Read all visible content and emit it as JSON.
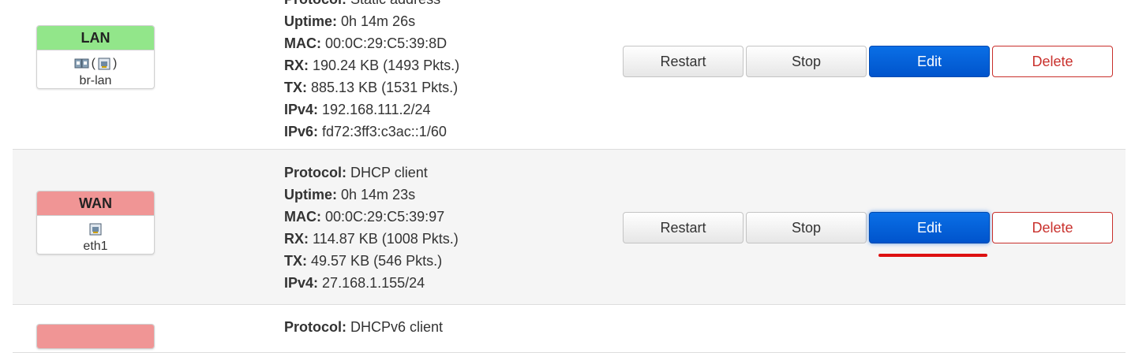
{
  "colors": {
    "lan_header": "#92e68a",
    "wan_header": "#f09595",
    "wan6_header": "#f09595",
    "edit_button": "#0060df",
    "delete_border": "#c9302c",
    "underline": "#dd1111"
  },
  "interfaces": [
    {
      "name": "LAN",
      "device": "br-lan",
      "icons": [
        "bridge-icon",
        "ethernet-port-icon"
      ],
      "info": {
        "protocol_label": "Protocol:",
        "protocol": "Static address",
        "uptime_label": "Uptime:",
        "uptime": "0h 14m 26s",
        "mac_label": "MAC:",
        "mac": "00:0C:29:C5:39:8D",
        "rx_label": "RX:",
        "rx": "190.24 KB (1493 Pkts.)",
        "tx_label": "TX:",
        "tx": "885.13 KB (1531 Pkts.)",
        "ipv4_label": "IPv4:",
        "ipv4": "192.168.111.2/24",
        "ipv6_label": "IPv6:",
        "ipv6": "fd72:3ff3:c3ac::1/60"
      }
    },
    {
      "name": "WAN",
      "device": "eth1",
      "icons": [
        "ethernet-port-icon"
      ],
      "info": {
        "protocol_label": "Protocol:",
        "protocol": "DHCP client",
        "uptime_label": "Uptime:",
        "uptime": "0h 14m 23s",
        "mac_label": "MAC:",
        "mac": "00:0C:29:C5:39:97",
        "rx_label": "RX:",
        "rx": "114.87 KB (1008 Pkts.)",
        "tx_label": "TX:",
        "tx": "49.57 KB (546 Pkts.)",
        "ipv4_label": "IPv4:",
        "ipv4": "27.168.1.155/24"
      }
    },
    {
      "info": {
        "protocol_label": "Protocol:",
        "protocol": "DHCPv6 client"
      }
    }
  ],
  "buttons": {
    "restart": "Restart",
    "stop": "Stop",
    "edit": "Edit",
    "delete": "Delete"
  },
  "icon_glyphs": {
    "bridge": "⇆",
    "ethernet": "▣",
    "paren_open": "(",
    "paren_close": ")"
  }
}
